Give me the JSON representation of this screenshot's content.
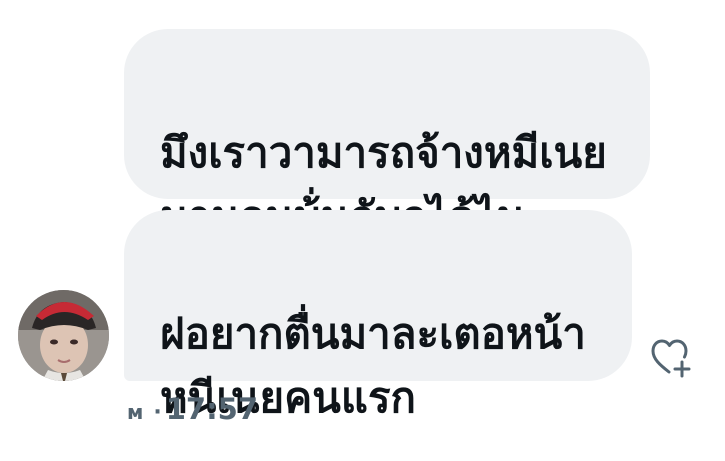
{
  "messages": [
    {
      "text": "มึงเราวามารถจ้างหมีเนย\nมานอนบ้่นกับกุได้ไม"
    },
    {
      "text": "ฝอยากตื่นมาละเตอหน้า\nหนีเนยคนแรก"
    }
  ],
  "meta": {
    "status": "м",
    "separator": "·",
    "time": "17:57"
  },
  "icons": {
    "reaction": "heart-add-icon",
    "avatar": "avatar"
  },
  "colors": {
    "bubble": "#eff1f3",
    "text": "#0f1419",
    "meta": "#536471",
    "cap": "#c62a35"
  }
}
